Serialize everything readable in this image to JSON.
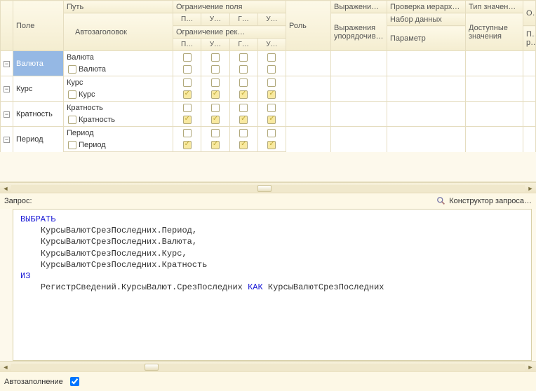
{
  "headers": {
    "field": "Поле",
    "path": "Путь",
    "autoheader": "Автозаголовок",
    "restrict_field": "Ограничение поля",
    "restrict_rec": "Ограничение рек…",
    "sub_p": "П…",
    "sub_u": "У…",
    "sub_g": "Г…",
    "sub_u2": "У…",
    "role": "Роль",
    "expr": "Выражени…",
    "expr_order": "Выражения упорядочив…",
    "hier": "Проверка иерархии:",
    "hier_ds": "Набор данных",
    "hier_param": "Параметр",
    "valtype": "Тип значен…",
    "valtype_avail": "Доступные значения",
    "rest1": "Оф",
    "rest2": "Па ре"
  },
  "rows": [
    {
      "field": "Валюта",
      "path": "Валюта",
      "child": "Валюта",
      "top": [
        false,
        false,
        false,
        false
      ],
      "bot": [
        false,
        false,
        false,
        false
      ],
      "sel": true
    },
    {
      "field": "Курс",
      "path": "Курс",
      "child": "Курс",
      "top": [
        false,
        false,
        false,
        false
      ],
      "bot": [
        true,
        true,
        true,
        true
      ],
      "sel": false
    },
    {
      "field": "Кратность",
      "path": "Кратность",
      "child": "Кратность",
      "top": [
        false,
        false,
        false,
        false
      ],
      "bot": [
        true,
        true,
        true,
        true
      ],
      "sel": false
    },
    {
      "field": "Период",
      "path": "Период",
      "child": "Период",
      "top": [
        false,
        false,
        false,
        false
      ],
      "bot": [
        true,
        true,
        true,
        true
      ],
      "sel": false
    }
  ],
  "query": {
    "label": "Запрос:",
    "constructor_link": "Конструктор запроса…",
    "kw_select": "ВЫБРАТЬ",
    "kw_from": "ИЗ",
    "kw_as": "КАК",
    "lines": [
      "КурсыВалютСрезПоследних.Период,",
      "КурсыВалютСрезПоследних.Валюта,",
      "КурсыВалютСрезПоследних.Курс,",
      "КурсыВалютСрезПоследних.Кратность"
    ],
    "from_line_pre": "РегистрСведений.КурсыВалют.СрезПоследних ",
    "from_line_post": " КурсыВалютСрезПоследних"
  },
  "footer": {
    "autofill": "Автозаполнение",
    "autofill_checked": true
  }
}
